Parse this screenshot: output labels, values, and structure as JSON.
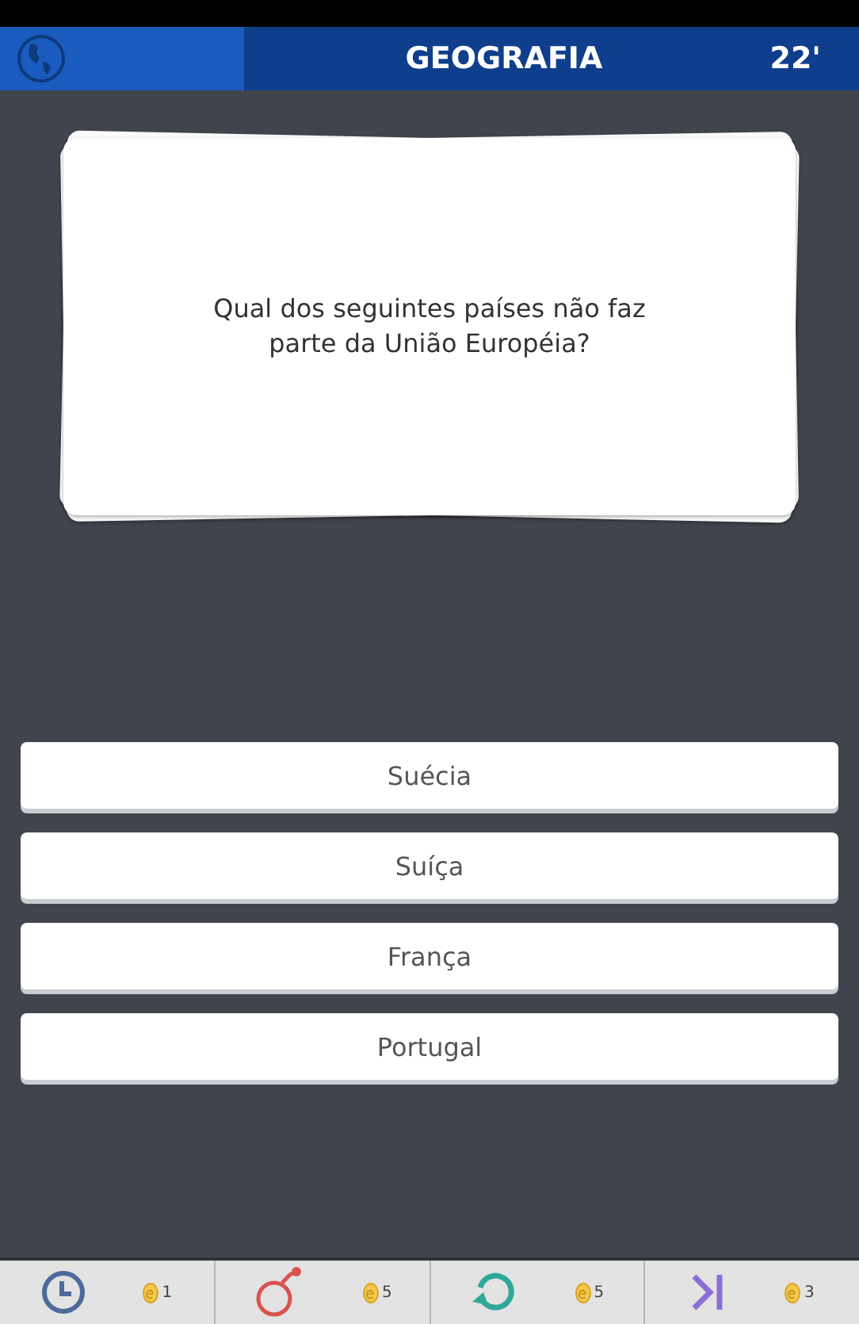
{
  "header": {
    "category": "GEOGRAFIA",
    "timer": "22'"
  },
  "question": "Qual dos seguintes países não faz parte da União Européia?",
  "answers": [
    {
      "label": "Suécia"
    },
    {
      "label": "Suíça"
    },
    {
      "label": "França"
    },
    {
      "label": "Portugal"
    }
  ],
  "powerups": [
    {
      "kind": "clock",
      "cost": "1"
    },
    {
      "kind": "bomb",
      "cost": "5"
    },
    {
      "kind": "refresh",
      "cost": "5"
    },
    {
      "kind": "skip",
      "cost": "3"
    }
  ]
}
